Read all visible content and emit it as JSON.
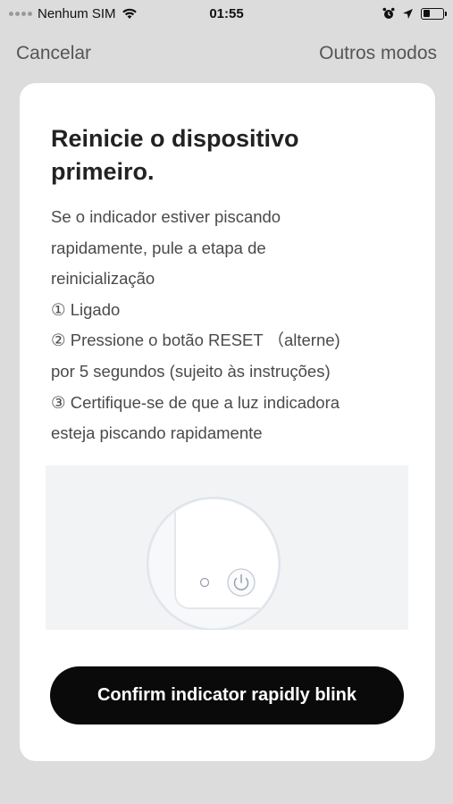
{
  "status_bar": {
    "carrier": "Nenhum SIM",
    "time": "01:55",
    "battery_level": 0.35
  },
  "nav": {
    "cancel_label": "Cancelar",
    "other_modes_label": "Outros modos"
  },
  "card": {
    "title_line1": "Reinicie o dispositivo",
    "title_line2": "primeiro.",
    "lines": [
      "Se o indicador estiver piscando",
      "rapidamente, pule a etapa de",
      "reinicialização",
      "① Ligado",
      "② Pressione o botão RESET （alterne)",
      "por 5 segundos (sujeito às instruções)",
      "③ Certifique-se de que a luz indicadora",
      "esteja piscando rapidamente"
    ],
    "confirm_label": "Confirm indicator rapidly blink"
  },
  "icons": {
    "wifi": "wifi-icon",
    "alarm": "alarm-icon",
    "location": "location-arrow-icon",
    "battery": "battery-icon",
    "power": "power-icon"
  }
}
